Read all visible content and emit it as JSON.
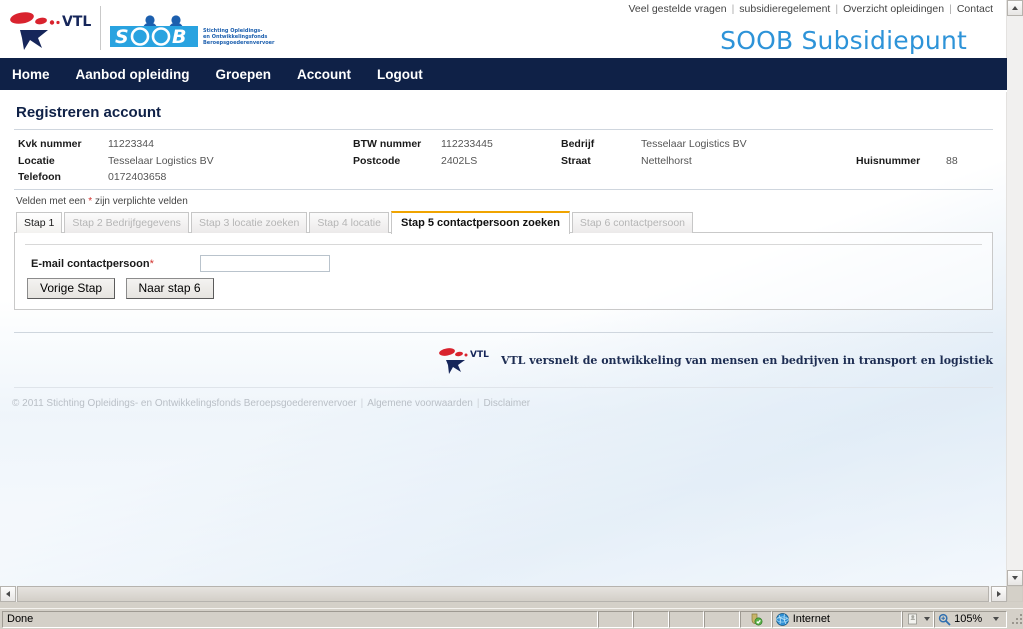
{
  "browser": {
    "status_text": "Done",
    "zone_label": "Internet",
    "zone_icon": "globe-icon",
    "protected_icon": "security-shield-icon",
    "zoom_level": "105%",
    "zoom_icon": "magnifier-icon"
  },
  "toplinks": [
    {
      "label": "Veel gestelde vragen"
    },
    {
      "label": "subsidieregelement"
    },
    {
      "label": "Overzicht opleidingen"
    },
    {
      "label": "Contact"
    }
  ],
  "header": {
    "vtl_logo_text": "VTL",
    "soob_logo_text": "SOOB",
    "soob_logo_subtext_line1": "Stichting Opleidings-",
    "soob_logo_subtext_line2": "en Ontwikkelingsfonds",
    "soob_logo_subtext_line3": "Beroepsgoederenvervoer",
    "site_title": "SOOB Subsidiepunt",
    "site_title_color": "#2d93d8"
  },
  "nav": {
    "items": [
      {
        "label": "Home"
      },
      {
        "label": "Aanbod opleiding"
      },
      {
        "label": "Groepen"
      },
      {
        "label": "Account"
      },
      {
        "label": "Logout"
      }
    ],
    "background_color": "#0f2147"
  },
  "main": {
    "page_title": "Registreren account",
    "info": {
      "row1": [
        {
          "label": "Kvk nummer",
          "value": "11223344"
        },
        {
          "label": "BTW nummer",
          "value": "112233445"
        },
        {
          "label": "Bedrijf",
          "value": "Tesselaar Logistics BV"
        }
      ],
      "row2": [
        {
          "label": "Locatie",
          "value": "Tesselaar Logistics BV"
        },
        {
          "label": "Postcode",
          "value": "2402LS"
        },
        {
          "label": "Straat",
          "value": "Nettelhorst"
        },
        {
          "label": "Huisnummer",
          "value": "88"
        }
      ],
      "row3": [
        {
          "label": "Telefoon",
          "value": "0172403658"
        }
      ]
    },
    "required_note_prefix": "Velden met een ",
    "required_note_star": "*",
    "required_note_suffix": " zijn verplichte velden",
    "required_star_color": "#d2322d",
    "tabs": [
      {
        "label": "Stap 1",
        "state": "enabled"
      },
      {
        "label": "Stap 2 Bedrijfgegevens",
        "state": "disabled"
      },
      {
        "label": "Stap 3 locatie zoeken",
        "state": "disabled"
      },
      {
        "label": "Stap 4 locatie",
        "state": "disabled"
      },
      {
        "label": "Stap 5 contactpersoon zoeken",
        "state": "active"
      },
      {
        "label": "Stap 6 contactpersoon",
        "state": "disabled"
      }
    ],
    "active_tab_accent": "#f0a400",
    "form": {
      "email_label": "E-mail contactpersoon",
      "email_label_star": "*",
      "email_value": "",
      "email_placeholder": "",
      "prev_button": "Vorige Stap",
      "next_button": "Naar stap 6"
    }
  },
  "footer": {
    "tagline": "VTL versnelt de ontwikkeling van mensen en bedrijven in transport en logistiek",
    "copyright": "© 2011 Stichting Opleidings- en Ontwikkelingsfonds Beroepsgoederenvervoer",
    "links": [
      {
        "label": "Algemene voorwaarden"
      },
      {
        "label": "Disclaimer"
      }
    ]
  }
}
